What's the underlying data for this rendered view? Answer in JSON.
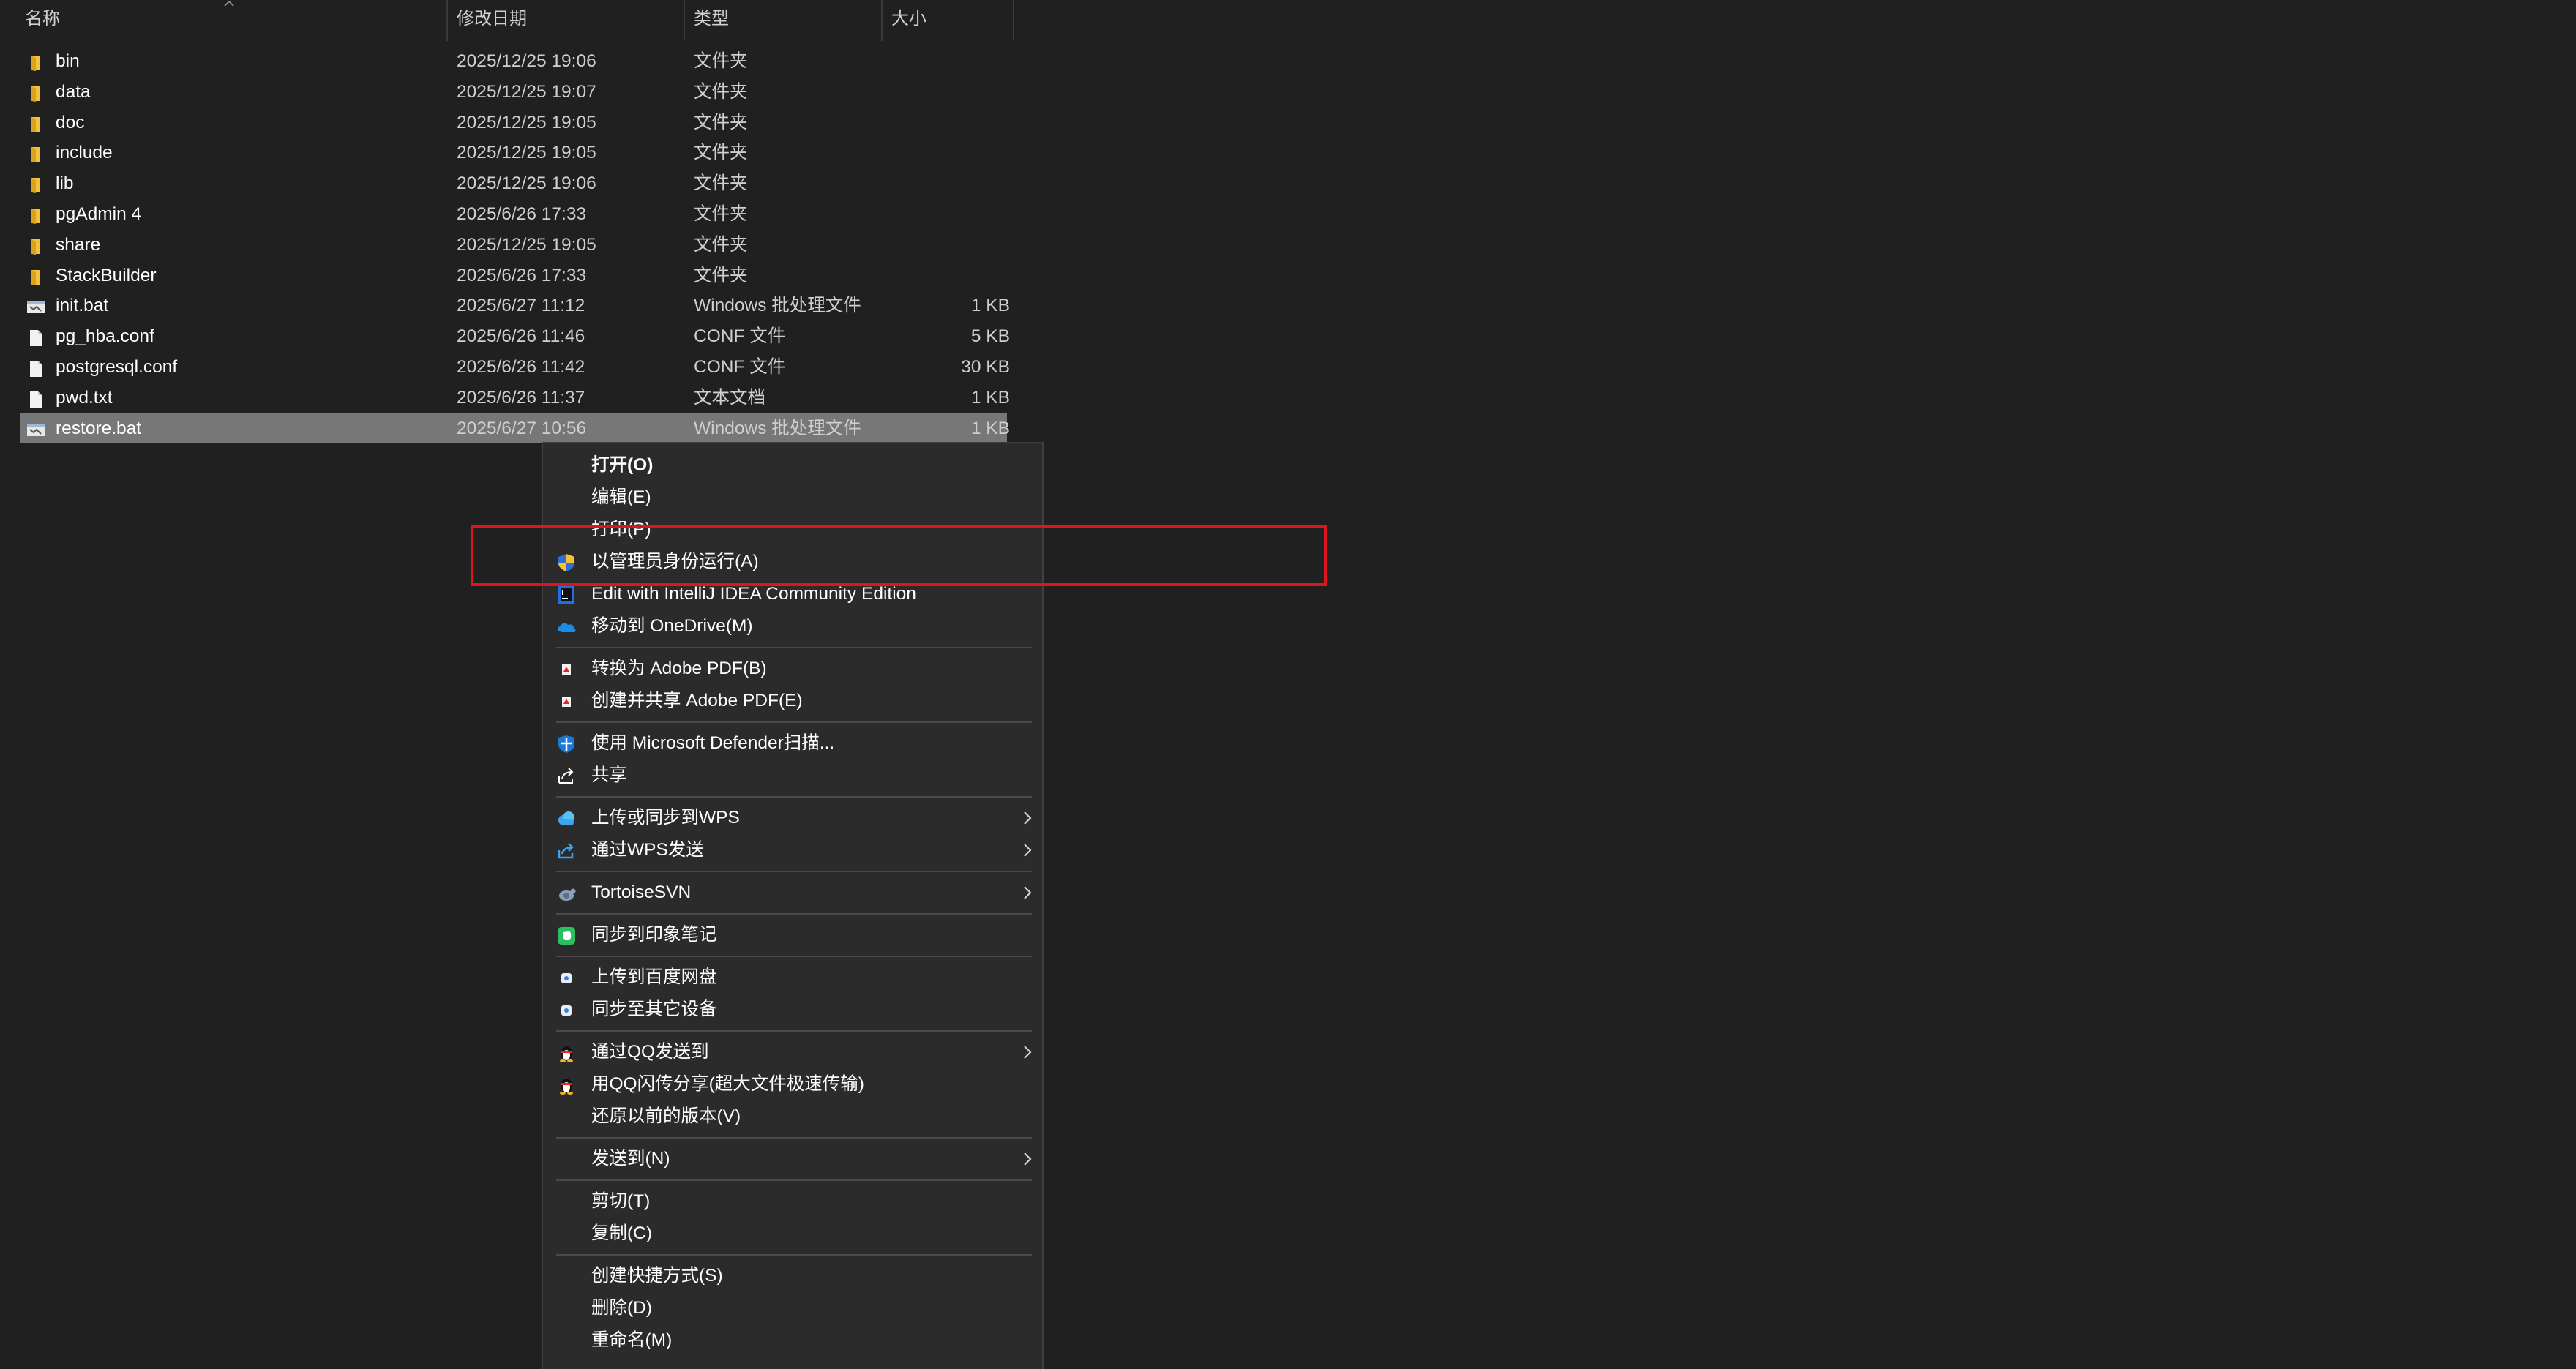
{
  "explorer": {
    "columns": {
      "name": "名称",
      "date": "修改日期",
      "type": "类型",
      "size": "大小"
    },
    "files": [
      {
        "name": "bin",
        "date": "2025/12/25 19:06",
        "type": "文件夹",
        "size": "",
        "icon": "folder-icon"
      },
      {
        "name": "data",
        "date": "2025/12/25 19:07",
        "type": "文件夹",
        "size": "",
        "icon": "folder-icon"
      },
      {
        "name": "doc",
        "date": "2025/12/25 19:05",
        "type": "文件夹",
        "size": "",
        "icon": "folder-icon"
      },
      {
        "name": "include",
        "date": "2025/12/25 19:05",
        "type": "文件夹",
        "size": "",
        "icon": "folder-icon"
      },
      {
        "name": "lib",
        "date": "2025/12/25 19:06",
        "type": "文件夹",
        "size": "",
        "icon": "folder-icon"
      },
      {
        "name": "pgAdmin 4",
        "date": "2025/6/26 17:33",
        "type": "文件夹",
        "size": "",
        "icon": "folder-icon"
      },
      {
        "name": "share",
        "date": "2025/12/25 19:05",
        "type": "文件夹",
        "size": "",
        "icon": "folder-icon"
      },
      {
        "name": "StackBuilder",
        "date": "2025/6/26 17:33",
        "type": "文件夹",
        "size": "",
        "icon": "folder-icon"
      },
      {
        "name": "init.bat",
        "date": "2025/6/27 11:12",
        "type": "Windows 批处理文件",
        "size": "1 KB",
        "icon": "batch-file-icon"
      },
      {
        "name": "pg_hba.conf",
        "date": "2025/6/26 11:46",
        "type": "CONF 文件",
        "size": "5 KB",
        "icon": "file-icon"
      },
      {
        "name": "postgresql.conf",
        "date": "2025/6/26 11:42",
        "type": "CONF 文件",
        "size": "30 KB",
        "icon": "file-icon"
      },
      {
        "name": "pwd.txt",
        "date": "2025/6/26 11:37",
        "type": "文本文档",
        "size": "1 KB",
        "icon": "text-file-icon"
      },
      {
        "name": "restore.bat",
        "date": "2025/6/27 10:56",
        "type": "Windows 批处理文件",
        "size": "1 KB",
        "icon": "batch-file-icon",
        "selected": true
      }
    ]
  },
  "context_menu": {
    "items": [
      {
        "label": "打开(O)",
        "bold": true
      },
      {
        "label": "编辑(E)"
      },
      {
        "label": "打印(P)"
      },
      {
        "label": "以管理员身份运行(A)",
        "icon": "uac-shield-icon"
      },
      {
        "label": "Edit with IntelliJ IDEA Community Edition",
        "icon": "intellij-idea-icon"
      },
      {
        "label": "移动到 OneDrive(M)",
        "icon": "onedrive-cloud-icon"
      },
      {
        "label": "转换为 Adobe PDF(B)",
        "icon": "adobe-pdf-icon",
        "sep_before": true
      },
      {
        "label": "创建并共享 Adobe PDF(E)",
        "icon": "adobe-pdf-icon"
      },
      {
        "label": "使用 Microsoft Defender扫描...",
        "icon": "defender-shield-icon",
        "sep_before": true
      },
      {
        "label": "共享",
        "icon": "share-icon"
      },
      {
        "label": "上传或同步到WPS",
        "icon": "wps-cloud-icon",
        "submenu": true,
        "sep_before": true
      },
      {
        "label": "通过WPS发送",
        "icon": "wps-send-icon",
        "submenu": true
      },
      {
        "label": "TortoiseSVN",
        "icon": "tortoisesvn-icon",
        "submenu": true,
        "sep_before": true
      },
      {
        "label": "同步到印象笔记",
        "icon": "evernote-icon",
        "sep_before": true
      },
      {
        "label": "上传到百度网盘",
        "icon": "baidu-netdisk-icon",
        "sep_before": true
      },
      {
        "label": "同步至其它设备",
        "icon": "baidu-netdisk-icon"
      },
      {
        "label": "通过QQ发送到",
        "icon": "qq-penguin-icon",
        "submenu": true,
        "sep_before": true
      },
      {
        "label": "用QQ闪传分享(超大文件极速传输)",
        "icon": "qq-penguin-icon"
      },
      {
        "label": "还原以前的版本(V)"
      },
      {
        "label": "发送到(N)",
        "submenu": true,
        "sep_before": true
      },
      {
        "label": "剪切(T)",
        "sep_before": true
      },
      {
        "label": "复制(C)"
      },
      {
        "label": "创建快捷方式(S)",
        "sep_before": true
      },
      {
        "label": "删除(D)"
      },
      {
        "label": "重命名(M)"
      }
    ]
  },
  "colors": {
    "background": "#202020",
    "menu_background": "#2b2b2b",
    "selection": "#777777",
    "highlight_box": "#e0141c"
  }
}
